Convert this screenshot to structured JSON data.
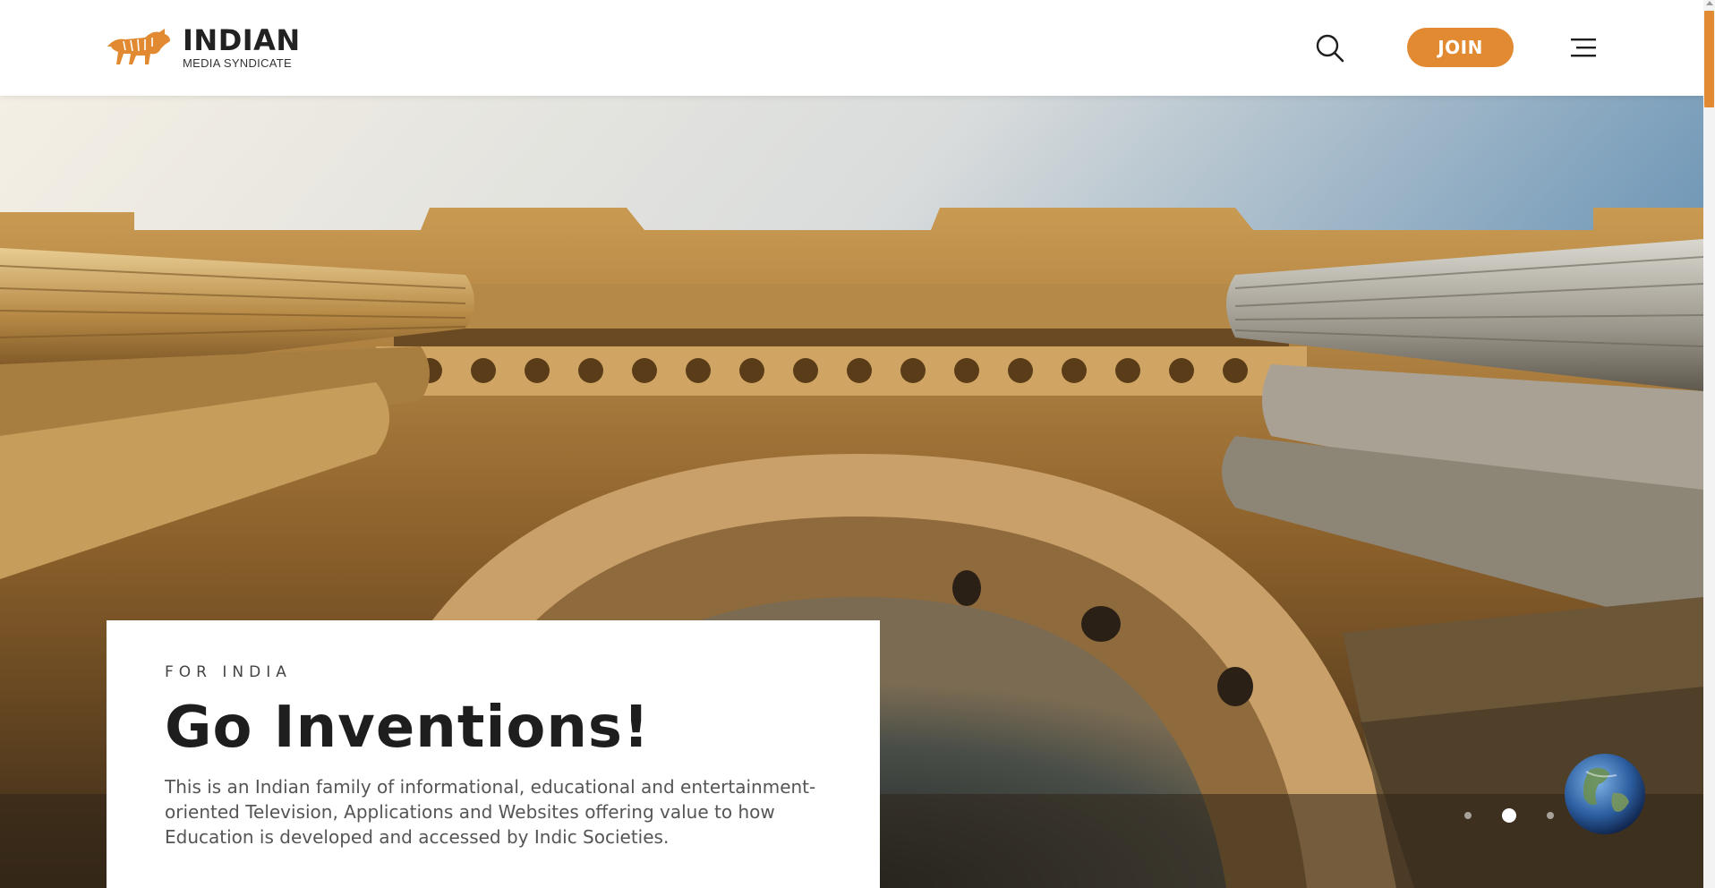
{
  "header": {
    "logo_title": "INDIAN",
    "logo_subtitle": "MEDIA SYNDICATE",
    "join_label": "JOIN",
    "icons": [
      "tiger-logo-icon",
      "search-icon",
      "hamburger-menu-icon"
    ]
  },
  "hero": {
    "eyebrow": "FOR INDIA",
    "headline": "Go Inventions!",
    "description": "This is an Indian family of informational, educational and entertainment-oriented Television, Applications and Websites offering value to how Education is developed and accessed by Indic Societies.",
    "slider_dots": 3,
    "active_slide": 2
  },
  "colors": {
    "accent": "#e18a32",
    "text_dark": "#1e1e1e",
    "text_body": "#555555",
    "background": "#ffffff"
  }
}
